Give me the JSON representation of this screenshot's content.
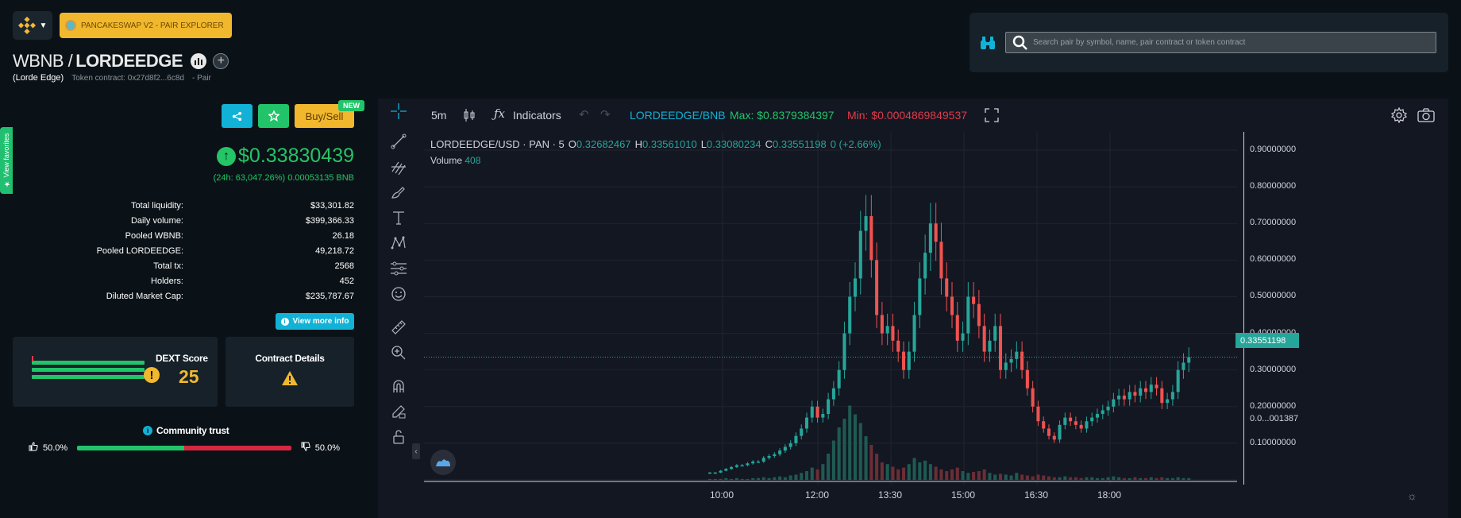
{
  "header": {
    "dex_badge": "PANCAKESWAP V2 - PAIR EXPLORER",
    "base": "WBNB /",
    "quote": "LORDEEDGE",
    "token_name": "(Lorde Edge)",
    "token_contract": "Token contract: 0x27d8f2...6c8d",
    "pair_link": "- Pair"
  },
  "favorites_tab": "★ View favorites",
  "actions": {
    "buy_sell": "Buy/Sell",
    "new_badge": "NEW"
  },
  "price": {
    "value": "$0.33830439",
    "change": "(24h: 63,047.26%) 0.00053135 BNB"
  },
  "stats": [
    {
      "label": "Total liquidity:",
      "value": "$33,301.82"
    },
    {
      "label": "Daily volume:",
      "value": "$399,366.33"
    },
    {
      "label": "Pooled WBNB:",
      "value": "26.18"
    },
    {
      "label": "Pooled LORDEEDGE:",
      "value": "49,218.72"
    },
    {
      "label": "Total tx:",
      "value": "2568"
    },
    {
      "label": "Holders:",
      "value": "452"
    },
    {
      "label": "Diluted Market Cap:",
      "value": "$235,787.67"
    }
  ],
  "more_info": "View more info",
  "dext": {
    "title": "DEXT Score",
    "score": "25"
  },
  "contract": {
    "title": "Contract Details"
  },
  "trust": {
    "title": "Community trust",
    "good": "50.0%",
    "bad": "50.0%",
    "good_fraction": 0.5
  },
  "search": {
    "placeholder": "Search pair by symbol, name, pair contract or token contract"
  },
  "chart_toolbar": {
    "timeframe": "5m",
    "indicators": "Indicators",
    "pair": "LORDEEDGE/BNB",
    "max": "Max: $0.8379384397",
    "min": "Min: $0.0004869849537"
  },
  "legend": {
    "symbol": "LORDEEDGE/USD · PAN · 5",
    "o_label": "O",
    "o": "0.32682467",
    "h_label": "H",
    "h": "0.33561010",
    "l_label": "L",
    "l": "0.33080234",
    "c_label": "C",
    "c": "0.33551198",
    "chg": "0 (+2.66%)",
    "volume_label": "Volume",
    "volume": "408"
  },
  "colors": {
    "up": "#26a69a",
    "down": "#ef5350",
    "accent": "#12b2d6"
  },
  "chart_data": {
    "type": "candlestick",
    "y_ticks": [
      "0.90000000",
      "0.80000000",
      "0.70000000",
      "0.60000000",
      "0.50000000",
      "0.40000000",
      "0.30000000",
      "0.20000000",
      "0.10000000",
      "0.0...001387"
    ],
    "last_price": "0.33551198",
    "x_ticks": [
      "10:00",
      "12:00",
      "13:30",
      "15:00",
      "16:30",
      "18:00"
    ],
    "ylim": [
      0,
      0.95
    ],
    "close_series": [
      0.02,
      0.02,
      0.025,
      0.03,
      0.035,
      0.04,
      0.04,
      0.045,
      0.05,
      0.05,
      0.06,
      0.065,
      0.07,
      0.08,
      0.09,
      0.1,
      0.12,
      0.14,
      0.17,
      0.2,
      0.17,
      0.18,
      0.22,
      0.25,
      0.3,
      0.4,
      0.5,
      0.55,
      0.68,
      0.72,
      0.6,
      0.45,
      0.4,
      0.42,
      0.38,
      0.35,
      0.3,
      0.35,
      0.45,
      0.55,
      0.62,
      0.7,
      0.65,
      0.55,
      0.5,
      0.45,
      0.38,
      0.4,
      0.5,
      0.48,
      0.42,
      0.35,
      0.38,
      0.42,
      0.3,
      0.32,
      0.33,
      0.35,
      0.3,
      0.25,
      0.2,
      0.16,
      0.14,
      0.12,
      0.11,
      0.15,
      0.17,
      0.16,
      0.15,
      0.14,
      0.16,
      0.17,
      0.18,
      0.19,
      0.2,
      0.22,
      0.23,
      0.22,
      0.24,
      0.23,
      0.25,
      0.24,
      0.26,
      0.25,
      0.21,
      0.22,
      0.24,
      0.3,
      0.32,
      0.335
    ],
    "volume_series": [
      1,
      1,
      1,
      2,
      1,
      2,
      1,
      1,
      2,
      2,
      3,
      2,
      3,
      4,
      3,
      5,
      6,
      8,
      10,
      14,
      12,
      18,
      30,
      45,
      60,
      70,
      85,
      75,
      65,
      50,
      40,
      30,
      20,
      18,
      15,
      12,
      14,
      18,
      25,
      20,
      22,
      18,
      15,
      12,
      10,
      12,
      14,
      10,
      8,
      9,
      10,
      12,
      8,
      6,
      7,
      6,
      5,
      8,
      6,
      5,
      4,
      6,
      5,
      4,
      3,
      3,
      4,
      3,
      3,
      2,
      3,
      3,
      2,
      2,
      3,
      4,
      3,
      2,
      2,
      3,
      2,
      2,
      3,
      2,
      3,
      2,
      2,
      3,
      2,
      2
    ]
  }
}
